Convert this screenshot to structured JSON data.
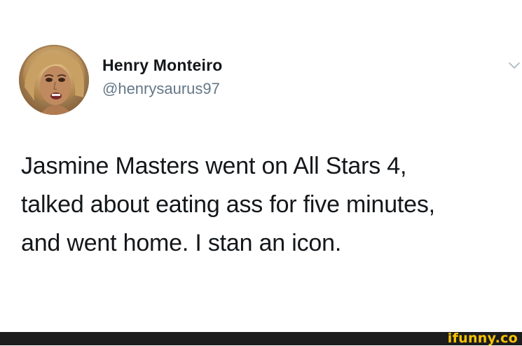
{
  "user": {
    "display_name": "Henry Monteiro",
    "handle": "@henrysaurus97",
    "avatar_icon": "profile-photo"
  },
  "menu": {
    "icon": "chevron-down-icon"
  },
  "tweet": {
    "lines": [
      "Jasmine Masters went on All Stars 4,",
      "talked about eating ass for five minutes,",
      "and went home. I stan an icon."
    ]
  },
  "footer": {
    "watermark": "ifunny.co",
    "bar_color": "#1c1c1c",
    "watermark_color": "#f6c300"
  }
}
